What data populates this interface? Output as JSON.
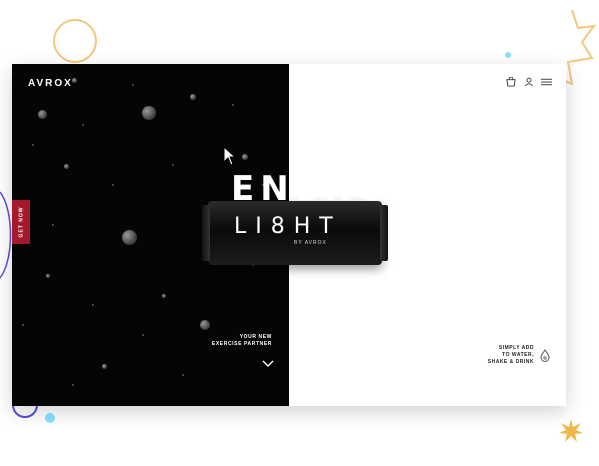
{
  "brand": {
    "logo": "AVROX"
  },
  "product": {
    "title_line1": "ENERGY",
    "title_line2": "LI8HT",
    "by": "BY AVROX"
  },
  "cta": {
    "get_now": "GET NOW"
  },
  "left_tagline": [
    "YOUR NEW",
    "EXERCISE PARTNER"
  ],
  "right_tagline": [
    "SIMPLY ADD",
    "TO WATER,",
    "SHAKE & DRINK"
  ],
  "icons": {
    "cart": "cart-icon",
    "user": "user-icon",
    "menu": "hamburger-menu-icon",
    "scroll": "chevron-down-icon",
    "drop": "water-drop-icon"
  },
  "colors": {
    "left_bg": "#050505",
    "right_bg": "#ffffff",
    "accent_red": "#a4192c",
    "deco_orange": "#f3c77f",
    "deco_cyan": "#86e3ff",
    "deco_blue": "#5a4fd6"
  }
}
